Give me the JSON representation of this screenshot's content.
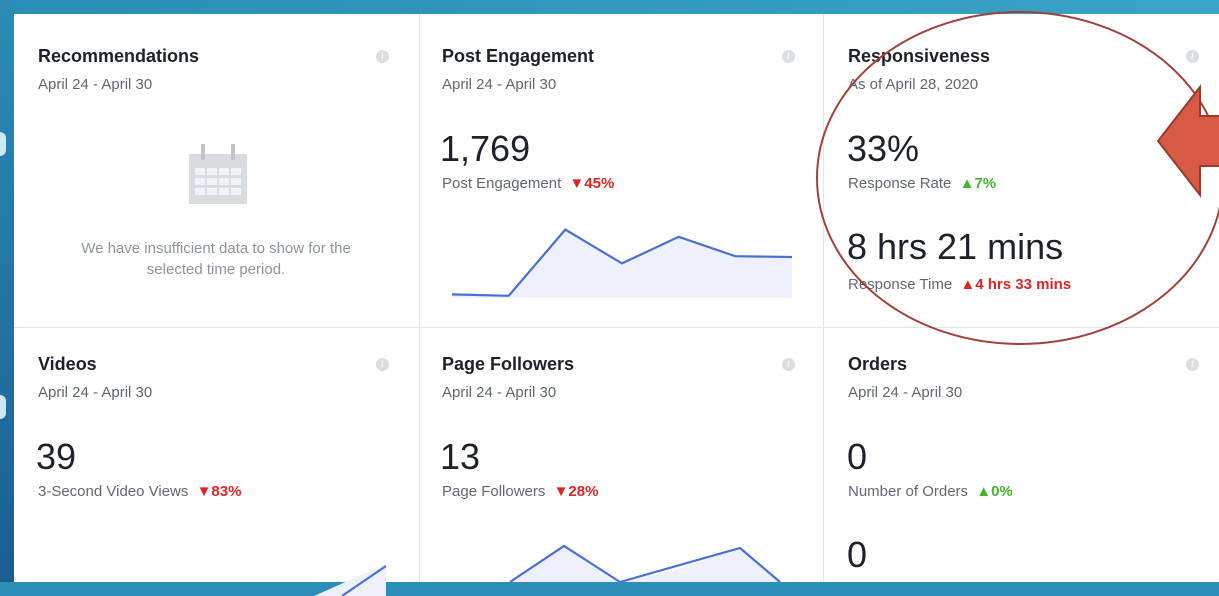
{
  "cards": {
    "recommendations": {
      "title": "Recommendations",
      "date": "April 24 - April 30",
      "empty_line1": "We have insufficient data to show for the",
      "empty_line2": "selected time period."
    },
    "post_engagement": {
      "title": "Post Engagement",
      "date": "April 24 - April 30",
      "value": "1,769",
      "metric": "Post Engagement",
      "change": "45%",
      "change_dir": "down",
      "sparkline": [
        0.05,
        0.03,
        0.95,
        0.48,
        0.85,
        0.58,
        0.57
      ]
    },
    "responsiveness": {
      "title": "Responsiveness",
      "date": "As of April 28, 2020",
      "rate_value": "33%",
      "rate_label": "Response Rate",
      "rate_change": "7%",
      "rate_dir": "up",
      "time_value": "8 hrs 21 mins",
      "time_label": "Response Time",
      "time_change": "4 hrs 33 mins",
      "time_dir": "up"
    },
    "videos": {
      "title": "Videos",
      "date": "April 24 - April 30",
      "value": "39",
      "metric": "3-Second Video Views",
      "change": "83%",
      "change_dir": "down"
    },
    "page_followers": {
      "title": "Page Followers",
      "date": "April 24 - April 30",
      "value": "13",
      "metric": "Page Followers",
      "change": "28%",
      "change_dir": "down"
    },
    "orders": {
      "title": "Orders",
      "date": "April 24 - April 30",
      "value": "0",
      "metric": "Number of Orders",
      "change": "0%",
      "change_dir": "up",
      "value2": "0"
    }
  },
  "glyphs": {
    "down_arrow": "▼",
    "up_arrow": "▲",
    "info": "i"
  },
  "colors": {
    "down": "#e02424",
    "up": "#42b72a",
    "line": "#4a6fd3",
    "fill": "#eef1fb",
    "annotation": "#a0413a",
    "arrow": "#d65a44"
  }
}
